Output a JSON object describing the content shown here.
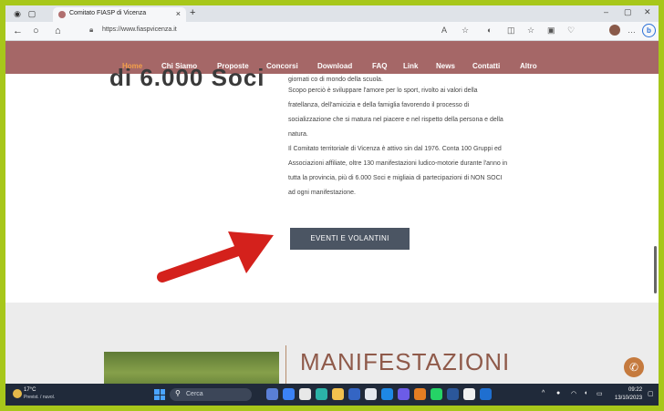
{
  "browser": {
    "tab_title": "Comitato FIASP di Vicenza",
    "url": "https://www.fiaspvicenza.it"
  },
  "site_nav": {
    "items": [
      "Home",
      "Chi Siamo",
      "Proposte",
      "Concorsi",
      "Download",
      "FAQ",
      "Link",
      "News",
      "Contatti",
      "Altro"
    ],
    "active": "Home",
    "active_color": "#f3a04a",
    "bar_color": "#a56767"
  },
  "content": {
    "big_text": "di 6.000 Soci",
    "partial_line": "giornati co di mondo della scuola.",
    "para1": [
      "Scopo perciò è sviluppare l'amore per lo sport, rivolto ai valori della",
      "fratellanza, dell'amicizia e della famiglia favorendo il processo di",
      "socializzazione che si matura nel piacere e nel rispetto della persona e della",
      "natura."
    ],
    "para2": [
      "Il Comitato territoriale di Vicenza è attivo sin dal 1976. Conta 100 Gruppi ed",
      "Associazioni affiliate, oltre 130 manifestazioni ludico-motorie durante l'anno in",
      "tutta la provincia, più di 6.000 Soci e migliaia di partecipazioni di NON SOCI",
      "ad ogni manifestazione."
    ],
    "cta_label": "EVENTI E VOLANTINI",
    "section_heading": "MANIFESTAZIONI"
  },
  "taskbar": {
    "temperature": "17°C",
    "weather_desc": "Previst. / nuvol.",
    "search_placeholder": "Cerca",
    "time": "09:22",
    "date": "13/10/2023"
  },
  "icons": [
    "back-arrow-icon",
    "forward-arrow-icon",
    "refresh-icon",
    "home-icon",
    "lock-icon",
    "favorites-icon",
    "windows-logo-icon",
    "search-icon",
    "bing-icon"
  ],
  "colors": {
    "frame": "#a7c71a",
    "cta_bg": "#4b5563",
    "heading": "#8f5a4a",
    "annotation_arrow": "#d4211c"
  }
}
